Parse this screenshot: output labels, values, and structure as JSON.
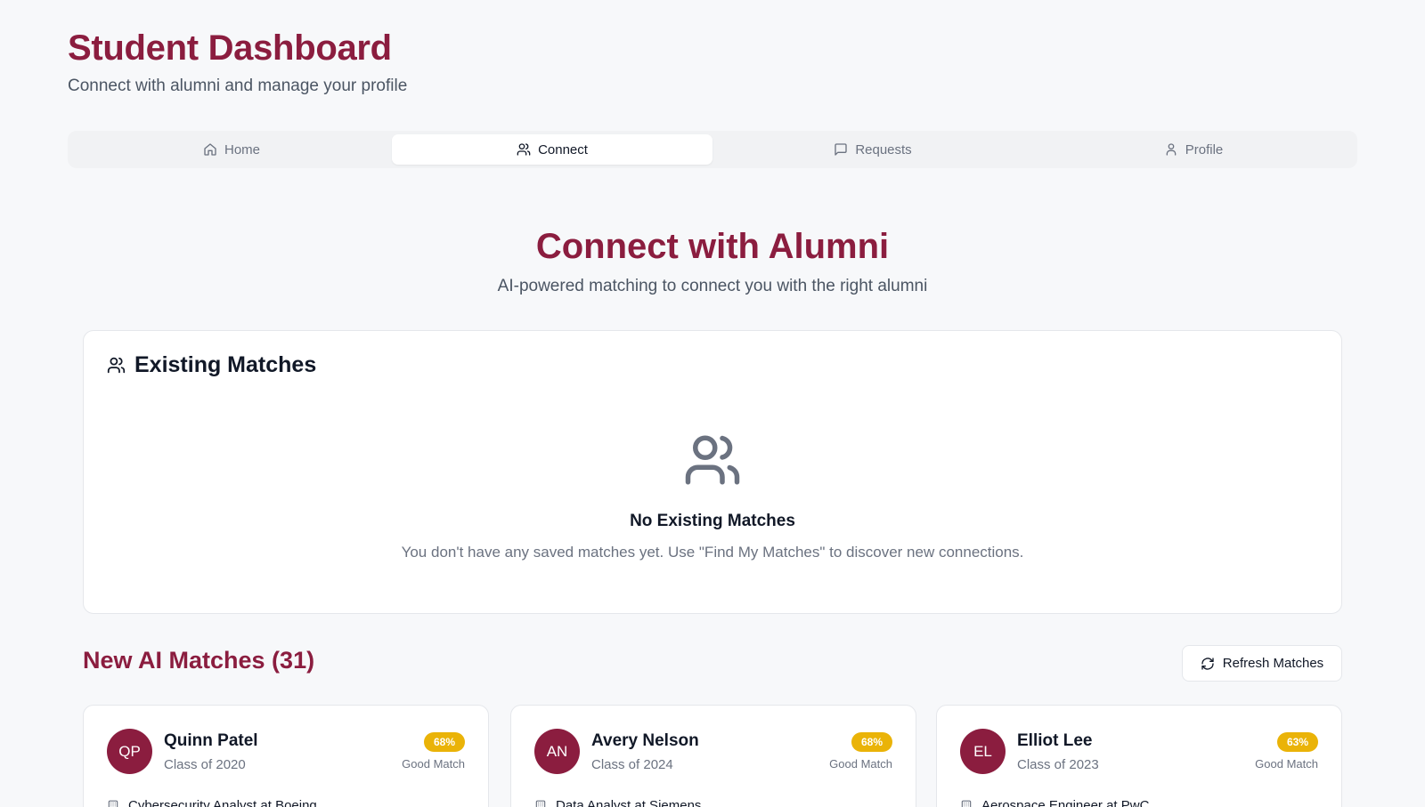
{
  "header": {
    "title": "Student Dashboard",
    "subtitle": "Connect with alumni and manage your profile"
  },
  "tabs": [
    {
      "label": "Home",
      "icon": "home-icon",
      "active": false
    },
    {
      "label": "Connect",
      "icon": "users-icon",
      "active": true
    },
    {
      "label": "Requests",
      "icon": "message-icon",
      "active": false
    },
    {
      "label": "Profile",
      "icon": "user-icon",
      "active": false
    }
  ],
  "hero": {
    "title": "Connect with Alumni",
    "subtitle": "AI-powered matching to connect you with the right alumni"
  },
  "existing": {
    "title": "Existing Matches",
    "empty_title": "No Existing Matches",
    "empty_text": "You don't have any saved matches yet. Use \"Find My Matches\" to discover new connections."
  },
  "new_matches": {
    "title": "New AI Matches (31)",
    "refresh_label": "Refresh Matches",
    "cards": [
      {
        "initials": "QP",
        "name": "Quinn Patel",
        "class": "Class of 2020",
        "score": "68%",
        "label": "Good Match",
        "role": "Cybersecurity Analyst at Boeing"
      },
      {
        "initials": "AN",
        "name": "Avery Nelson",
        "class": "Class of 2024",
        "score": "68%",
        "label": "Good Match",
        "role": "Data Analyst at Siemens"
      },
      {
        "initials": "EL",
        "name": "Elliot Lee",
        "class": "Class of 2023",
        "score": "63%",
        "label": "Good Match",
        "role": "Aerospace Engineer at PwC"
      }
    ]
  },
  "colors": {
    "brand": "#8b1d3f",
    "badge": "#eab308",
    "background": "#f7f8fa"
  }
}
